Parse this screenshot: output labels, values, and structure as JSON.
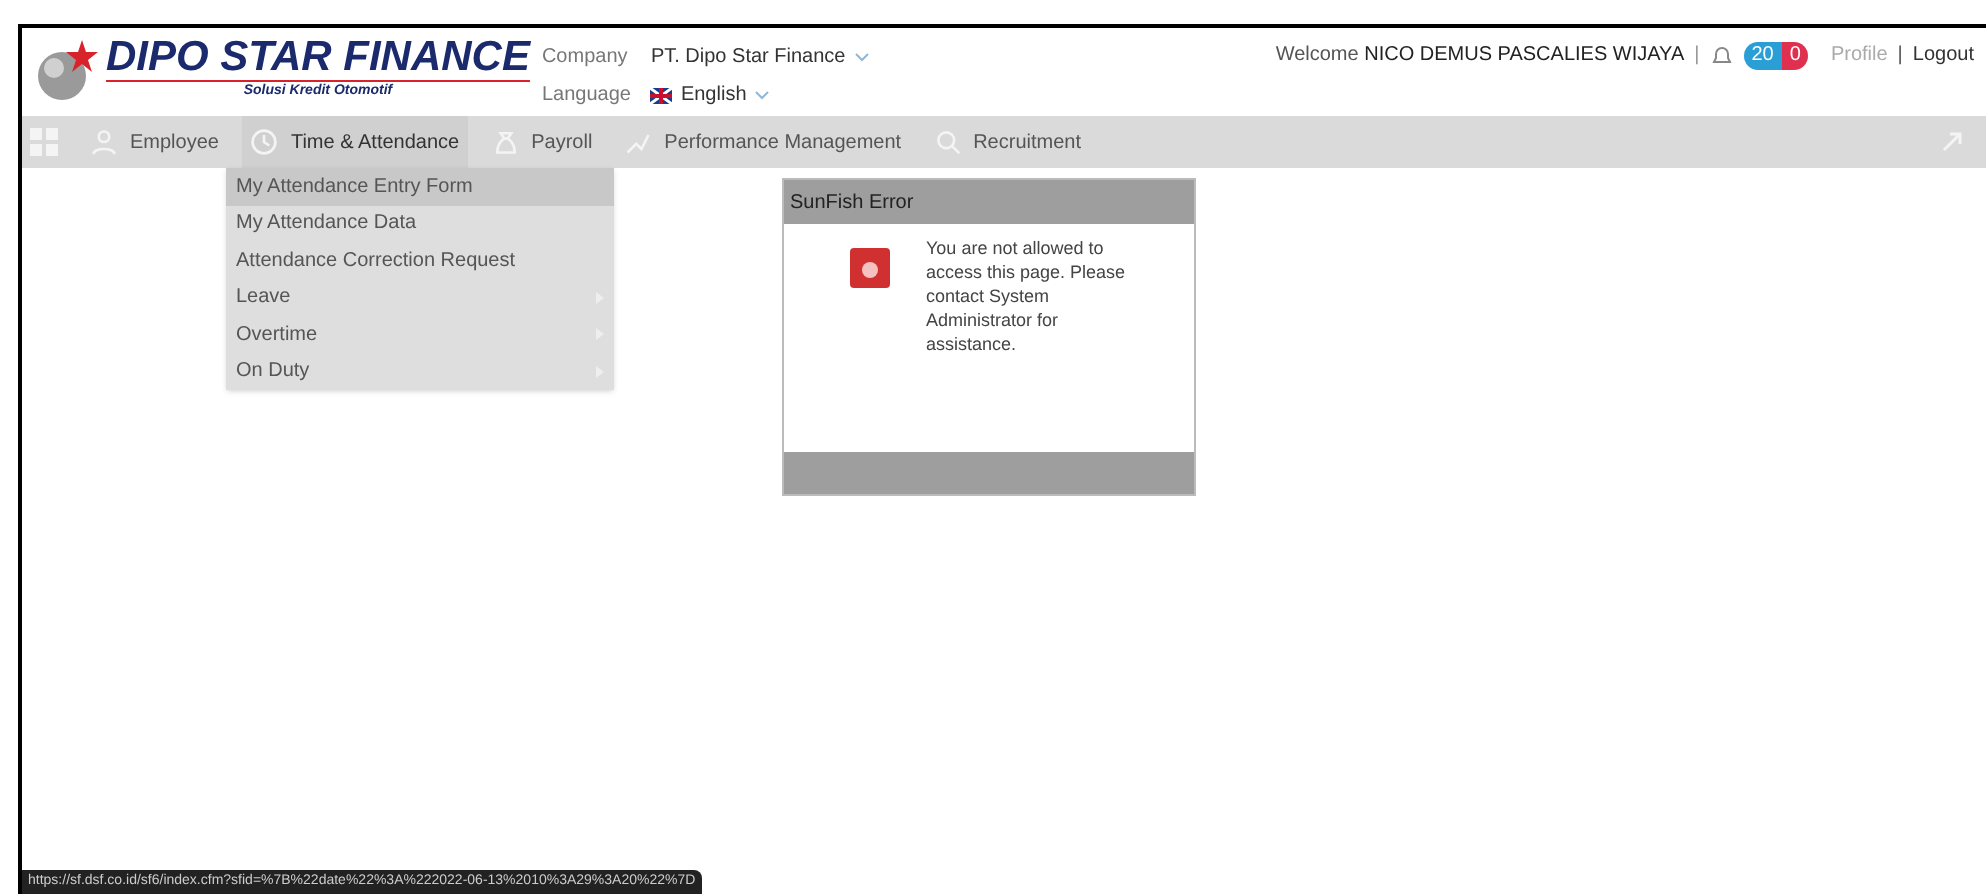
{
  "logo": {
    "title": "DIPO STAR FINANCE",
    "tagline": "Solusi Kredit Otomotif"
  },
  "company": {
    "label": "Company",
    "value": "PT. Dipo Star Finance"
  },
  "language": {
    "label": "Language",
    "value": "English"
  },
  "user": {
    "welcome": "Welcome",
    "name": "NICO DEMUS PASCALIES WIJAYA",
    "separator": "|",
    "notifications": "20",
    "alerts": "0",
    "profile": "Profile",
    "divider": "|",
    "logout": "Logout"
  },
  "nav": [
    {
      "label": "Employee",
      "selected": false
    },
    {
      "label": "Time & Attendance",
      "selected": true
    },
    {
      "label": "Payroll",
      "selected": false
    },
    {
      "label": "Performance Management",
      "selected": false
    },
    {
      "label": "Recruitment",
      "selected": false
    }
  ],
  "menu": [
    {
      "label": "My Attendance Entry Form",
      "selected": true,
      "submenu": false
    },
    {
      "label": "My Attendance Data",
      "selected": false,
      "submenu": false
    },
    {
      "label": "Attendance Correction Request",
      "selected": false,
      "submenu": false
    },
    {
      "label": "Leave",
      "selected": false,
      "submenu": true
    },
    {
      "label": "Overtime",
      "selected": false,
      "submenu": true
    },
    {
      "label": "On Duty",
      "selected": false,
      "submenu": true
    }
  ],
  "dialog": {
    "title": "SunFish Error",
    "message": "You are not allowed to access this page. Please contact System Administrator for assistance."
  },
  "status_bar": {
    "url": "https://sf.dsf.co.id/sf6/index.cfm?sfid=%7B%22date%22%3A%222022-06-13%2010%3A29%3A20%22%7D"
  }
}
